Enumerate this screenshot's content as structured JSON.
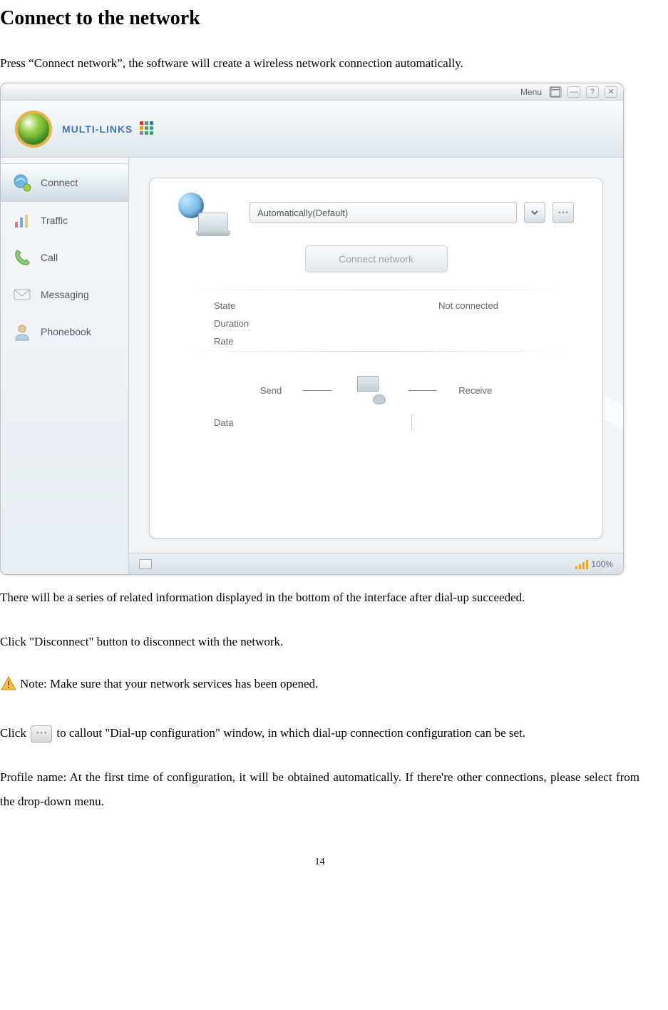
{
  "heading": "Connect to the network",
  "para1": "Press “Connect network”, the software will create a wireless network connection automatically.",
  "para2": "There will be a series of related information displayed in the bottom of the interface after dial-up succeeded.",
  "para3": "Click \"Disconnect\" button to disconnect with the network.",
  "note": "Note: Make sure that your network services has been opened.",
  "para4a": "Click ",
  "para4b": "to callout \"Dial-up configuration\" window, in which dial-up connection configuration can be set.",
  "para5": "Profile name: At the first time of configuration, it will be obtained automatically. If there're other connections, please select from the drop-down menu.",
  "page_number": "14",
  "app": {
    "titlebar": {
      "menu": "Menu"
    },
    "brand": "MULTI-LINKS",
    "sidebar": {
      "items": [
        {
          "label": "Connect"
        },
        {
          "label": "Traffic"
        },
        {
          "label": "Call"
        },
        {
          "label": "Messaging"
        },
        {
          "label": "Phonebook"
        }
      ]
    },
    "panel": {
      "profile_value": "Automatically(Default)",
      "connect_label": "Connect network",
      "state_label": "State",
      "state_value": "Not connected",
      "duration_label": "Duration",
      "rate_label": "Rate",
      "send_label": "Send",
      "receive_label": "Receive",
      "data_label": "Data"
    },
    "statusbar": {
      "signal_pct": "100%"
    }
  }
}
